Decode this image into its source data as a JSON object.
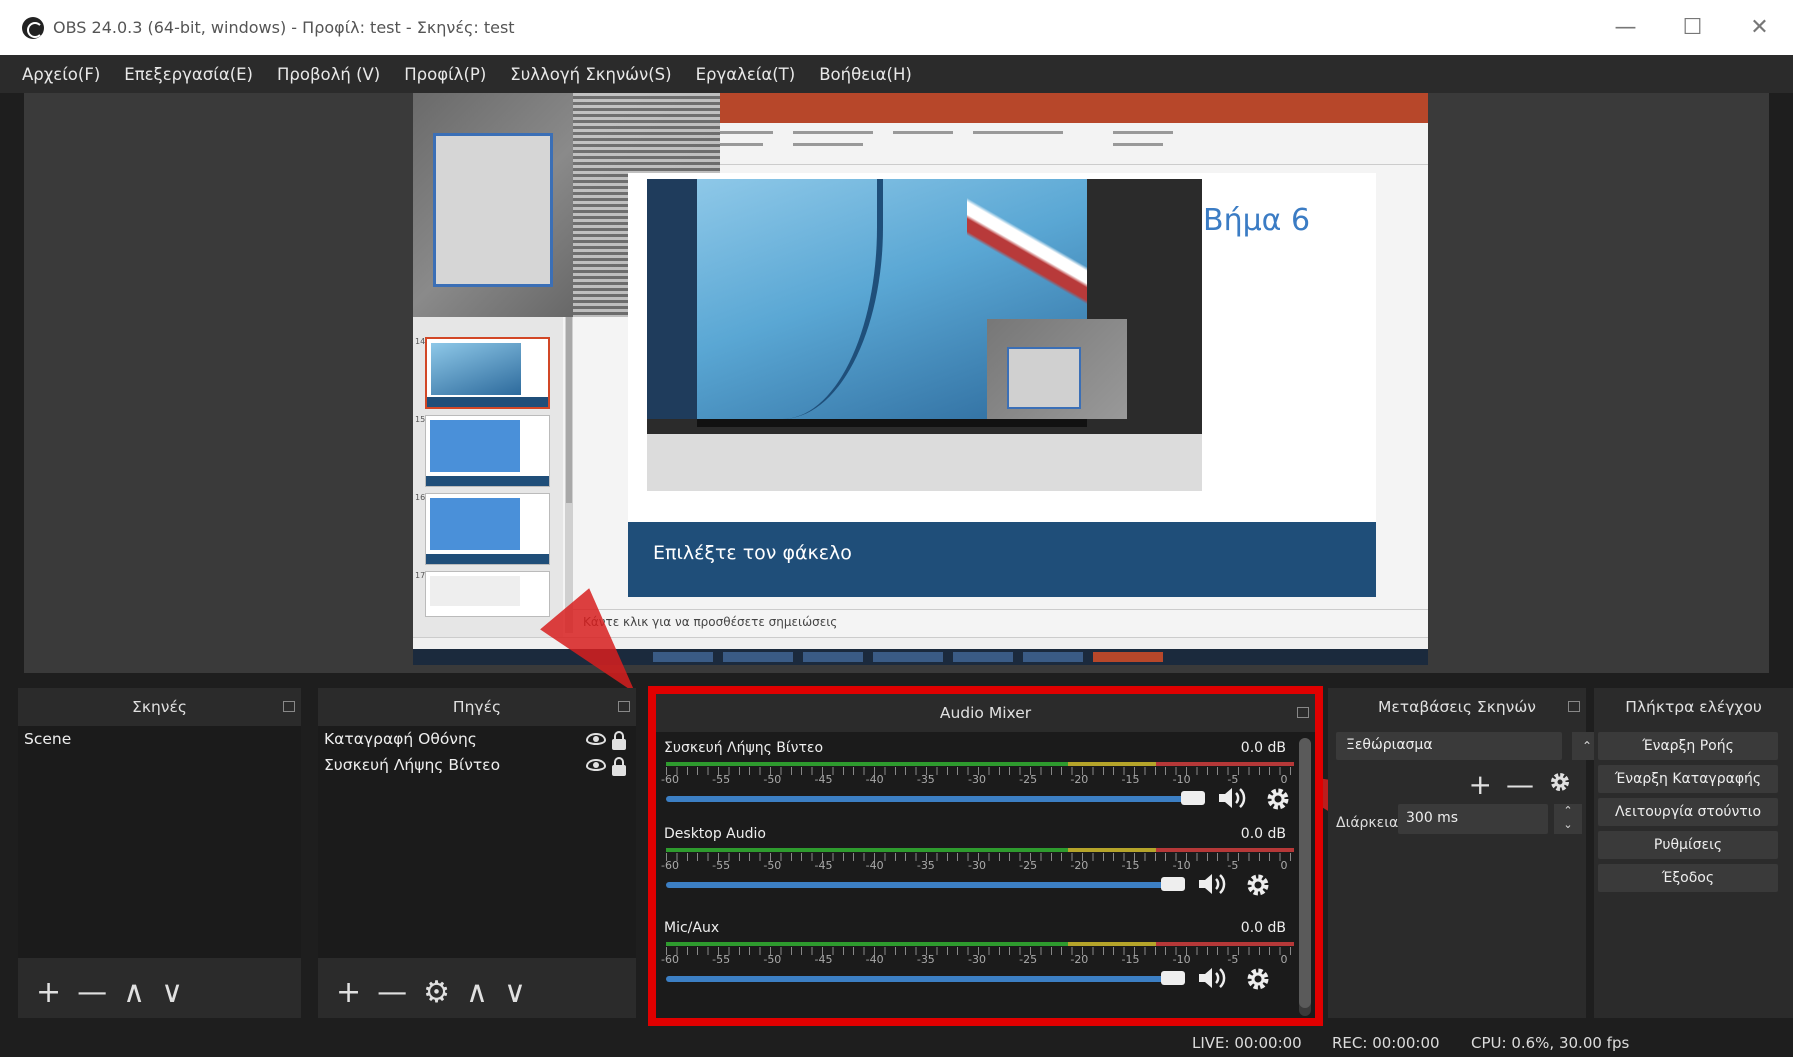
{
  "window": {
    "title": "OBS 24.0.3 (64-bit, windows) - Προφίλ: test - Σκηνές: test",
    "minimize": "—",
    "maximize": "☐",
    "close": "✕"
  },
  "menu": [
    "Αρχείο(F)",
    "Επεξεργασία(E)",
    "Προβολή (V)",
    "Προφίλ(P)",
    "Συλλογή Σκηνών(S)",
    "Εργαλεία(T)",
    "Βοήθεια(H)"
  ],
  "preview": {
    "slide_title": "Βήμα 6",
    "slide_caption": "Επιλέξτε τον φάκελο",
    "notes_placeholder": "Κάντε κλικ για να προσθέσετε σημειώσεις",
    "thumb_numbers": [
      "14",
      "15",
      "16",
      "17"
    ]
  },
  "scenes": {
    "title": "Σκηνές",
    "items": [
      "Scene"
    ],
    "controls": [
      "+",
      "—",
      "∧",
      "∨"
    ]
  },
  "sources": {
    "title": "Πηγές",
    "items": [
      "Καταγραφή Οθόνης",
      "Συσκευή Λήψης Βίντεο"
    ],
    "controls": [
      "+",
      "—",
      "⚙",
      "∧",
      "∨"
    ]
  },
  "mixer": {
    "title": "Audio Mixer",
    "tick_labels": [
      "-60",
      "-55",
      "-50",
      "-45",
      "-40",
      "-35",
      "-30",
      "-25",
      "-20",
      "-15",
      "-10",
      "-5",
      "0"
    ],
    "channels": [
      {
        "name": "Συσκευή Λήψης Βίντεο",
        "db": "0.0 dB",
        "volume": 1.0
      },
      {
        "name": "Desktop Audio",
        "db": "0.0 dB",
        "volume": 1.0
      },
      {
        "name": "Mic/Aux",
        "db": "0.0 dB",
        "volume": 1.0
      }
    ]
  },
  "transitions": {
    "title": "Μεταβάσεις Σκηνών",
    "selected": "Ξεθώριασμα",
    "duration_label": "Διάρκεια",
    "duration_value": "300 ms",
    "controls": [
      "+",
      "—"
    ]
  },
  "controls_dock": {
    "title": "Πλήκτρα ελέγχου",
    "buttons": [
      "Έναρξη Ροής",
      "Έναρξη Καταγραφής",
      "Λειτουργία στούντιο",
      "Ρυθμίσεις",
      "Έξοδος"
    ]
  },
  "status": {
    "live": "LIVE: 00:00:00",
    "rec": "REC: 00:00:00",
    "cpu": "CPU: 0.6%, 30.00 fps"
  },
  "colors": {
    "highlight": "#e00000",
    "fader": "#3c7fc4",
    "slide_accent": "#1f4e79"
  }
}
